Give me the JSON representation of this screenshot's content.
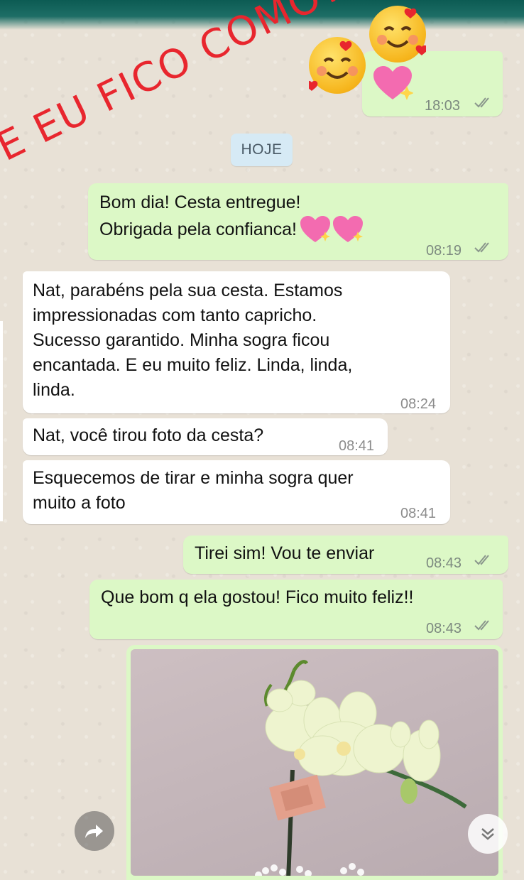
{
  "overlay": {
    "caption": "E EU FICO COMO?"
  },
  "day_chip": "HOJE",
  "messages": [
    {
      "id": "m0",
      "time": "18:03"
    },
    {
      "id": "m1",
      "lines": [
        "Bom dia! Cesta entregue!",
        "Obrigada pela confianca!"
      ],
      "time": "08:19"
    },
    {
      "id": "m2",
      "lines": [
        "Nat, parabéns pela sua cesta. Estamos",
        "impressionadas com tanto capricho.",
        "Sucesso garantido. Minha sogra ficou",
        "encantada. E eu muito feliz. Linda, linda,",
        "linda."
      ],
      "time": "08:24"
    },
    {
      "id": "m3",
      "text": "Nat, você tirou foto da cesta?",
      "time": "08:41"
    },
    {
      "id": "m4",
      "lines": [
        "Esquecemos de tirar e minha sogra quer",
        "muito a foto"
      ],
      "time": "08:41"
    },
    {
      "id": "m5",
      "text": "Tirei sim! Vou te enviar",
      "time": "08:43"
    },
    {
      "id": "m6",
      "text": "Que bom q ela gostou! Fico muito feliz!!",
      "time": "08:43"
    }
  ],
  "icons": {
    "forward": "forward-arrow-icon",
    "scroll_down": "double-chevron-down-icon",
    "read_receipt": "double-check-icon",
    "sticker": "smiling-face-with-hearts-emoji",
    "hearts": "sparkling-heart-emoji"
  },
  "colors": {
    "outgoing": "#dcf8c6",
    "incoming": "#ffffff",
    "overlay_text": "#e8262e",
    "header": "#0c5b53"
  }
}
